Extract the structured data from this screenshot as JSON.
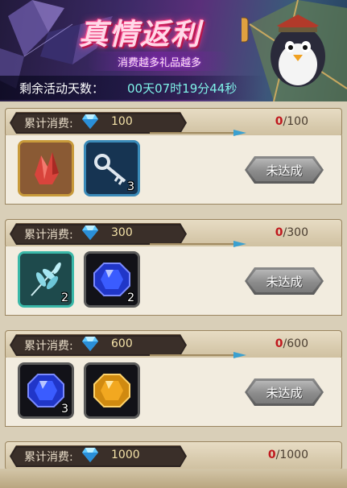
{
  "banner": {
    "title": "真情返利",
    "subtitle": "消费越多礼品越多",
    "countdown_label": "剩余活动天数：",
    "countdown_value": "00天07时19分44秒"
  },
  "tiers": [
    {
      "label": "累计消费:",
      "amount": "100",
      "progress_current": "0",
      "progress_total": "/100",
      "button_label": "未达成",
      "rewards": [
        {
          "icon": "red-crystal-icon",
          "qty": ""
        },
        {
          "icon": "key-icon",
          "qty": "3"
        }
      ]
    },
    {
      "label": "累计消费:",
      "amount": "300",
      "progress_current": "0",
      "progress_total": "/300",
      "button_label": "未达成",
      "rewards": [
        {
          "icon": "feather-leaf-icon",
          "qty": "2"
        },
        {
          "icon": "blue-gem-icon",
          "qty": "2"
        }
      ]
    },
    {
      "label": "累计消费:",
      "amount": "600",
      "progress_current": "0",
      "progress_total": "/600",
      "button_label": "未达成",
      "rewards": [
        {
          "icon": "blue-gem-icon",
          "qty": "3"
        },
        {
          "icon": "gold-gem-icon",
          "qty": ""
        }
      ]
    },
    {
      "label": "累计消费:",
      "amount": "1000",
      "progress_current": "0",
      "progress_total": "/1000"
    }
  ],
  "colors": {
    "progress_current": "#c0181e",
    "countdown": "#7ff2e8",
    "title_glow": "#ff2d7a"
  }
}
